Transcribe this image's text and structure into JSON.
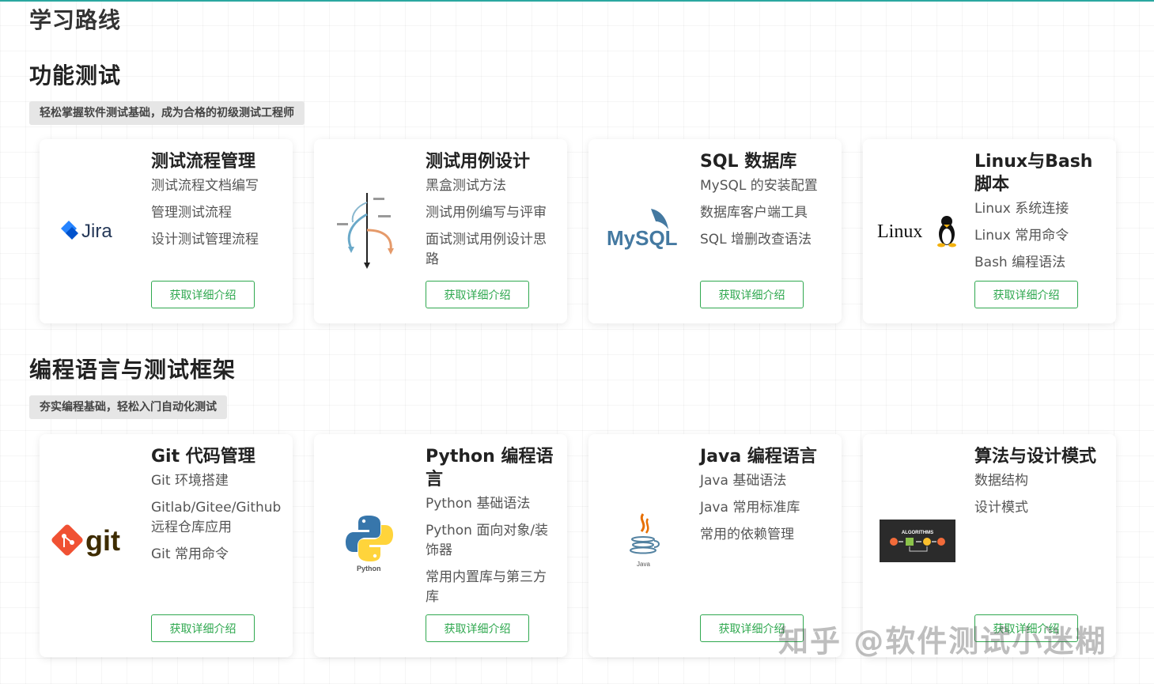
{
  "page": {
    "heading": "学习路线"
  },
  "brand": {
    "accent": "#2fa84f",
    "tag_bg": "#e6e6e6"
  },
  "sections": [
    {
      "title": "功能测试",
      "tagline": "轻松掌握软件测试基础，成为合格的初级测试工程师",
      "cards": [
        {
          "title": "测试流程管理",
          "items": [
            "测试流程文档编写",
            "管理测试流程",
            "设计测试管理流程"
          ],
          "logo_text": "Jira",
          "cta": "获取详细介绍"
        },
        {
          "title": "测试用例设计",
          "items": [
            "黑盒测试方法",
            "测试用例编写与评审",
            "面试测试用例设计思路"
          ],
          "cta": "获取详细介绍"
        },
        {
          "title": "SQL 数据库",
          "items": [
            "MySQL 的安装配置",
            "数据库客户端工具",
            "SQL 增删改查语法"
          ],
          "logo_text": "MySQL",
          "cta": "获取详细介绍"
        },
        {
          "title": "Linux与Bash脚本",
          "items": [
            "Linux 系统连接",
            "Linux 常用命令",
            "Bash 编程语法"
          ],
          "logo_text": "Linux",
          "cta": "获取详细介绍"
        }
      ]
    },
    {
      "title": "编程语言与测试框架",
      "tagline": "夯实编程基础，轻松入门自动化测试",
      "cards": [
        {
          "title": "Git 代码管理",
          "items": [
            "Git 环境搭建",
            "Gitlab/Gitee/Github 远程仓库应用",
            "Git 常用命令"
          ],
          "logo_text": "git",
          "cta": "获取详细介绍"
        },
        {
          "title": "Python 编程语言",
          "items": [
            "Python 基础语法",
            "Python 面向对象/装饰器",
            "常用内置库与第三方库"
          ],
          "logo_text": "Python",
          "cta": "获取详细介绍"
        },
        {
          "title": "Java 编程语言",
          "items": [
            "Java 基础语法",
            "Java 常用标准库",
            "常用的依赖管理"
          ],
          "logo_text": "Java",
          "cta": "获取详细介绍"
        },
        {
          "title": "算法与设计模式",
          "items": [
            "数据结构",
            "设计模式"
          ],
          "logo_text": "ALGORITHMS",
          "cta": "获取详细介绍"
        }
      ]
    }
  ],
  "watermark": "知乎 @软件测试小迷糊"
}
